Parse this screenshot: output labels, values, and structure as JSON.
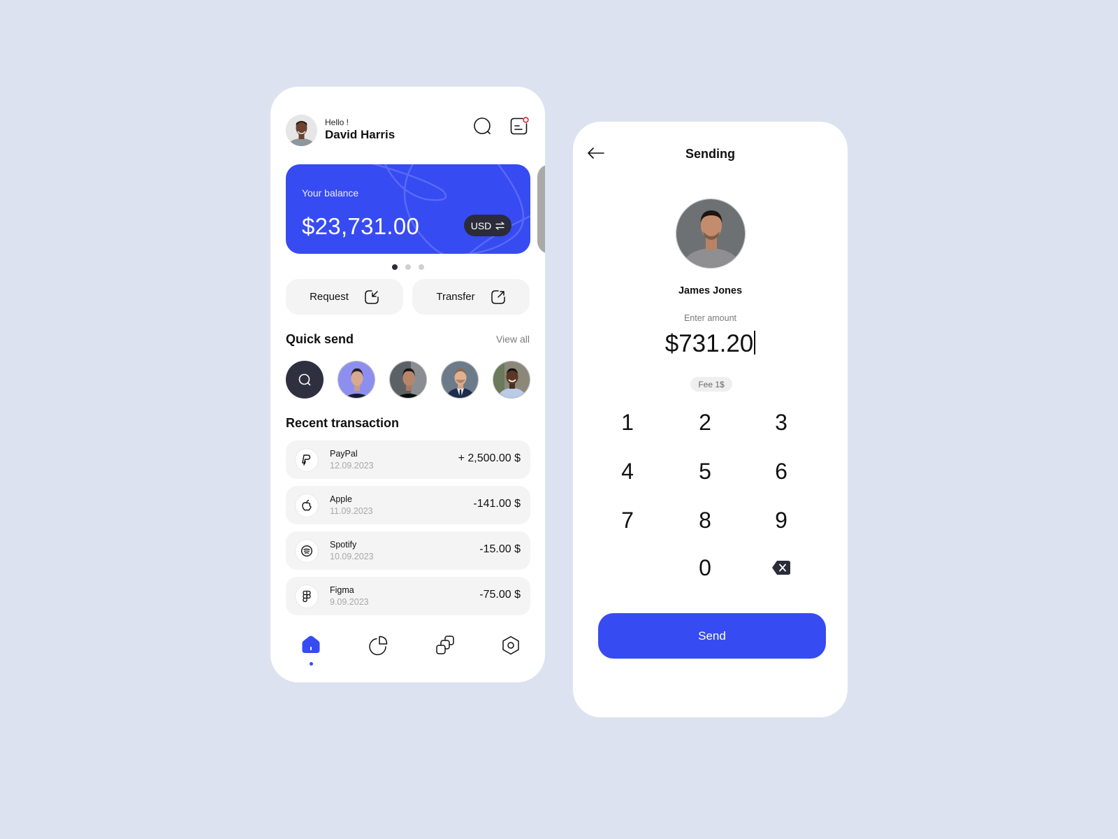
{
  "colors": {
    "background": "#dde2f1",
    "accent": "#374bf2",
    "dark": "#2b2c3a",
    "notification": "#e0262b"
  },
  "home": {
    "greeting": "Hello !",
    "user_name": "David Harris",
    "header_icons": [
      "search-icon",
      "message-icon"
    ],
    "balance": {
      "label": "Your balance",
      "value": "$23,731.00",
      "currency": "USD",
      "currency_icon": "swap-icon"
    },
    "carousel": {
      "pages": 3,
      "active_page": 1
    },
    "actions": {
      "request_label": "Request",
      "transfer_label": "Transfer"
    },
    "quick_send": {
      "title": "Quick send",
      "view_all": "View all",
      "contacts": [
        "contact-1",
        "contact-2",
        "contact-3",
        "contact-4"
      ]
    },
    "recent": {
      "title": "Recent transaction",
      "transactions": [
        {
          "name": "PayPal",
          "date": "12.09.2023",
          "amount": "+ 2,500.00 $",
          "icon": "paypal-icon"
        },
        {
          "name": "Apple",
          "date": "11.09.2023",
          "amount": "-141.00 $",
          "icon": "apple-icon"
        },
        {
          "name": "Spotify",
          "date": "10.09.2023",
          "amount": "-15.00 $",
          "icon": "spotify-icon"
        },
        {
          "name": "Figma",
          "date": "9.09.2023",
          "amount": "-75.00 $",
          "icon": "figma-icon"
        }
      ]
    },
    "nav": {
      "items": [
        "home",
        "analytics",
        "cards",
        "settings"
      ],
      "active": "home"
    }
  },
  "sending": {
    "title": "Sending",
    "recipient_name": "James Jones",
    "enter_label": "Enter amount",
    "amount": "$731.20",
    "fee": "Fee 1$",
    "keys": [
      "1",
      "2",
      "3",
      "4",
      "5",
      "6",
      "7",
      "8",
      "9",
      "0"
    ],
    "send_label": "Send"
  }
}
